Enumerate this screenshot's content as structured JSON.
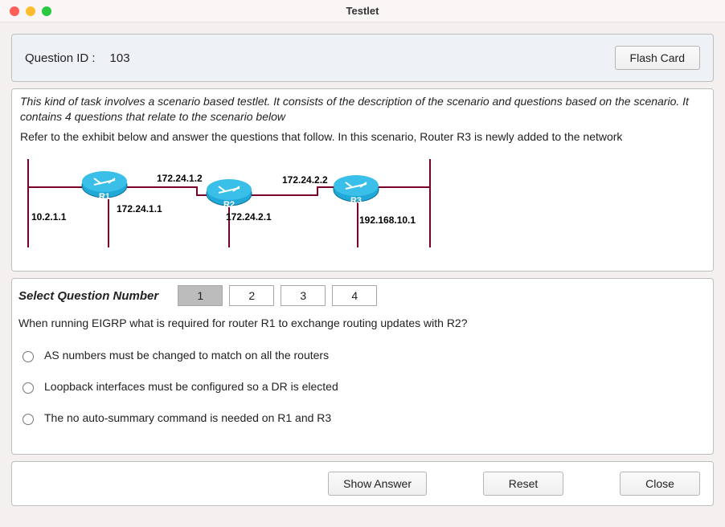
{
  "window": {
    "title": "Testlet"
  },
  "header": {
    "qid_label": "Question ID :",
    "qid_value": "103",
    "flashcard_label": "Flash Card"
  },
  "scenario": {
    "intro": "This kind of task involves a scenario based testlet. It consists of the description of the scenario and questions based on the scenario. It contains 4 questions that relate to the scenario below",
    "refer": "Refer to the exhibit below and answer the questions that follow. In this scenario, Router R3 is newly added to the network",
    "diagram": {
      "routers": [
        {
          "name": "R1",
          "left_ip": "10.2.1.1",
          "right_ip": "172.24.1.1"
        },
        {
          "name": "R2",
          "left_ip": "172.24.1.2",
          "right_ip": "172.24.2.1"
        },
        {
          "name": "R3",
          "left_ip": "172.24.2.2",
          "right_ip": "192.168.10.1"
        }
      ]
    }
  },
  "question_selector": {
    "label": "Select Question Number",
    "tabs": [
      "1",
      "2",
      "3",
      "4"
    ],
    "active": 0
  },
  "question": {
    "text": "When running EIGRP what is required for router R1 to exchange routing updates with R2?",
    "options": [
      "AS numbers must be changed to match on all the routers",
      "Loopback interfaces must be configured so a DR is elected",
      "The no auto-summary command is needed on R1 and R3"
    ]
  },
  "footer": {
    "show_answer": "Show Answer",
    "reset": "Reset",
    "close": "Close"
  }
}
